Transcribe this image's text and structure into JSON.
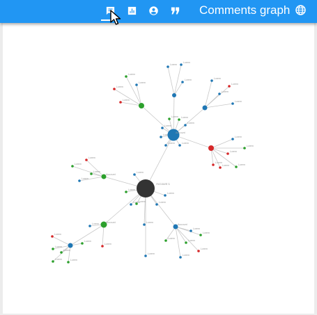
{
  "toolbar": {
    "tabs": [
      {
        "icon": "comment-icon",
        "active": true
      },
      {
        "icon": "bar-chart-icon",
        "active": false
      },
      {
        "icon": "account-circle-icon",
        "active": false
      },
      {
        "icon": "quote-icon",
        "active": false
      }
    ],
    "title": "Comments graph",
    "language_icon": "globe-icon"
  },
  "graph": {
    "colors": {
      "root": "#333333",
      "blue": "#1f77b4",
      "green": "#2ca02c",
      "red": "#d62728",
      "edge": "#c8c8c8"
    },
    "root_label": "Account 1",
    "node_labels": {
      "small": "Lorem",
      "hub": "Account"
    }
  }
}
